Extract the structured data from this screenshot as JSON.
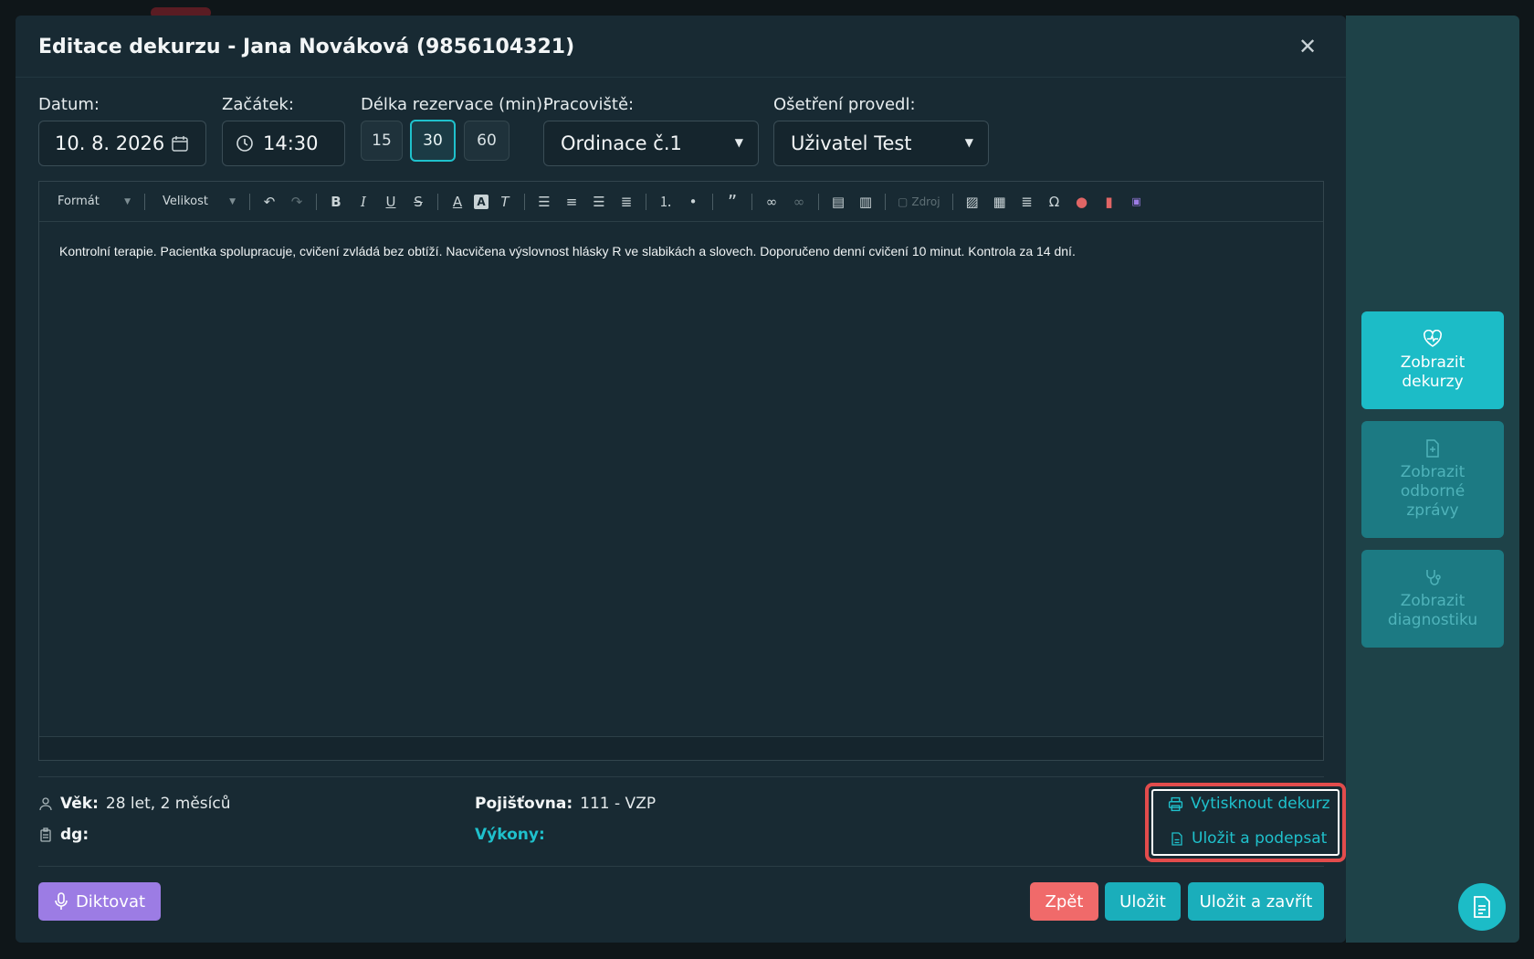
{
  "modal": {
    "title": "Editace dekurzu - Jana Nováková (9856104321)",
    "close_icon": "close-icon"
  },
  "form": {
    "date_label": "Datum:",
    "date_value": "10. 8. 2026",
    "start_label": "Začátek:",
    "start_value": "14:30",
    "duration_label": "Délka rezervace (min):",
    "durations": [
      "15",
      "30",
      "60"
    ],
    "duration_selected": "30",
    "workplace_label": "Pracoviště:",
    "workplace_value": "Ordinace č.1",
    "performed_by_label": "Ošetření provedl:",
    "performed_by_value": "Uživatel Test"
  },
  "editor": {
    "format_label": "Formát",
    "size_label": "Velikost",
    "source_label": "Zdroj",
    "content": "Kontrolní terapie. Pacientka spolupracuje, cvičení zvládá bez obtíží. Nacvičena výslovnost hlásky R ve slabikách a slovech. Doporučeno denní cvičení 10 minut. Kontrola za 14 dní."
  },
  "patient_info": {
    "age_label": "Věk:",
    "age_value": "28 let, 2 měsíců",
    "dg_label": "dg:",
    "insurance_label": "Pojišťovna:",
    "insurance_value": "111 - VZP",
    "procedures_label": "Výkony:"
  },
  "actions": {
    "print_label": "Vytisknout dekurz",
    "save_sign_label": "Uložit a podepsat"
  },
  "footer": {
    "dictate_label": "Diktovat",
    "back_label": "Zpět",
    "save_label": "Uložit",
    "save_close_label": "Uložit a zavřít"
  },
  "sidebar": {
    "show_records": "Zobrazit dekurzy",
    "show_reports": "Zobrazit odborné zprávy",
    "show_diagnostics": "Zobrazit diagnostiku"
  },
  "colors": {
    "accent": "#1fc1cc",
    "danger": "#f06a6a",
    "purple": "#9c7ce4",
    "modal_bg": "#182a33"
  }
}
